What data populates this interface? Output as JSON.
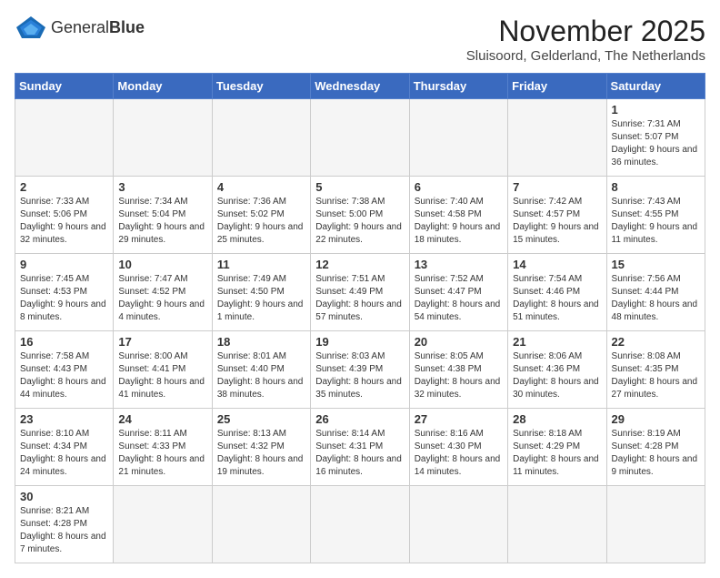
{
  "header": {
    "logo_text_regular": "General",
    "logo_text_bold": "Blue",
    "month_title": "November 2025",
    "location": "Sluisoord, Gelderland, The Netherlands"
  },
  "weekdays": [
    "Sunday",
    "Monday",
    "Tuesday",
    "Wednesday",
    "Thursday",
    "Friday",
    "Saturday"
  ],
  "weeks": [
    [
      {
        "day": "",
        "info": ""
      },
      {
        "day": "",
        "info": ""
      },
      {
        "day": "",
        "info": ""
      },
      {
        "day": "",
        "info": ""
      },
      {
        "day": "",
        "info": ""
      },
      {
        "day": "",
        "info": ""
      },
      {
        "day": "1",
        "info": "Sunrise: 7:31 AM\nSunset: 5:07 PM\nDaylight: 9 hours and 36 minutes."
      }
    ],
    [
      {
        "day": "2",
        "info": "Sunrise: 7:33 AM\nSunset: 5:06 PM\nDaylight: 9 hours and 32 minutes."
      },
      {
        "day": "3",
        "info": "Sunrise: 7:34 AM\nSunset: 5:04 PM\nDaylight: 9 hours and 29 minutes."
      },
      {
        "day": "4",
        "info": "Sunrise: 7:36 AM\nSunset: 5:02 PM\nDaylight: 9 hours and 25 minutes."
      },
      {
        "day": "5",
        "info": "Sunrise: 7:38 AM\nSunset: 5:00 PM\nDaylight: 9 hours and 22 minutes."
      },
      {
        "day": "6",
        "info": "Sunrise: 7:40 AM\nSunset: 4:58 PM\nDaylight: 9 hours and 18 minutes."
      },
      {
        "day": "7",
        "info": "Sunrise: 7:42 AM\nSunset: 4:57 PM\nDaylight: 9 hours and 15 minutes."
      },
      {
        "day": "8",
        "info": "Sunrise: 7:43 AM\nSunset: 4:55 PM\nDaylight: 9 hours and 11 minutes."
      }
    ],
    [
      {
        "day": "9",
        "info": "Sunrise: 7:45 AM\nSunset: 4:53 PM\nDaylight: 9 hours and 8 minutes."
      },
      {
        "day": "10",
        "info": "Sunrise: 7:47 AM\nSunset: 4:52 PM\nDaylight: 9 hours and 4 minutes."
      },
      {
        "day": "11",
        "info": "Sunrise: 7:49 AM\nSunset: 4:50 PM\nDaylight: 9 hours and 1 minute."
      },
      {
        "day": "12",
        "info": "Sunrise: 7:51 AM\nSunset: 4:49 PM\nDaylight: 8 hours and 57 minutes."
      },
      {
        "day": "13",
        "info": "Sunrise: 7:52 AM\nSunset: 4:47 PM\nDaylight: 8 hours and 54 minutes."
      },
      {
        "day": "14",
        "info": "Sunrise: 7:54 AM\nSunset: 4:46 PM\nDaylight: 8 hours and 51 minutes."
      },
      {
        "day": "15",
        "info": "Sunrise: 7:56 AM\nSunset: 4:44 PM\nDaylight: 8 hours and 48 minutes."
      }
    ],
    [
      {
        "day": "16",
        "info": "Sunrise: 7:58 AM\nSunset: 4:43 PM\nDaylight: 8 hours and 44 minutes."
      },
      {
        "day": "17",
        "info": "Sunrise: 8:00 AM\nSunset: 4:41 PM\nDaylight: 8 hours and 41 minutes."
      },
      {
        "day": "18",
        "info": "Sunrise: 8:01 AM\nSunset: 4:40 PM\nDaylight: 8 hours and 38 minutes."
      },
      {
        "day": "19",
        "info": "Sunrise: 8:03 AM\nSunset: 4:39 PM\nDaylight: 8 hours and 35 minutes."
      },
      {
        "day": "20",
        "info": "Sunrise: 8:05 AM\nSunset: 4:38 PM\nDaylight: 8 hours and 32 minutes."
      },
      {
        "day": "21",
        "info": "Sunrise: 8:06 AM\nSunset: 4:36 PM\nDaylight: 8 hours and 30 minutes."
      },
      {
        "day": "22",
        "info": "Sunrise: 8:08 AM\nSunset: 4:35 PM\nDaylight: 8 hours and 27 minutes."
      }
    ],
    [
      {
        "day": "23",
        "info": "Sunrise: 8:10 AM\nSunset: 4:34 PM\nDaylight: 8 hours and 24 minutes."
      },
      {
        "day": "24",
        "info": "Sunrise: 8:11 AM\nSunset: 4:33 PM\nDaylight: 8 hours and 21 minutes."
      },
      {
        "day": "25",
        "info": "Sunrise: 8:13 AM\nSunset: 4:32 PM\nDaylight: 8 hours and 19 minutes."
      },
      {
        "day": "26",
        "info": "Sunrise: 8:14 AM\nSunset: 4:31 PM\nDaylight: 8 hours and 16 minutes."
      },
      {
        "day": "27",
        "info": "Sunrise: 8:16 AM\nSunset: 4:30 PM\nDaylight: 8 hours and 14 minutes."
      },
      {
        "day": "28",
        "info": "Sunrise: 8:18 AM\nSunset: 4:29 PM\nDaylight: 8 hours and 11 minutes."
      },
      {
        "day": "29",
        "info": "Sunrise: 8:19 AM\nSunset: 4:28 PM\nDaylight: 8 hours and 9 minutes."
      }
    ],
    [
      {
        "day": "30",
        "info": "Sunrise: 8:21 AM\nSunset: 4:28 PM\nDaylight: 8 hours and 7 minutes."
      },
      {
        "day": "",
        "info": ""
      },
      {
        "day": "",
        "info": ""
      },
      {
        "day": "",
        "info": ""
      },
      {
        "day": "",
        "info": ""
      },
      {
        "day": "",
        "info": ""
      },
      {
        "day": "",
        "info": ""
      }
    ]
  ]
}
